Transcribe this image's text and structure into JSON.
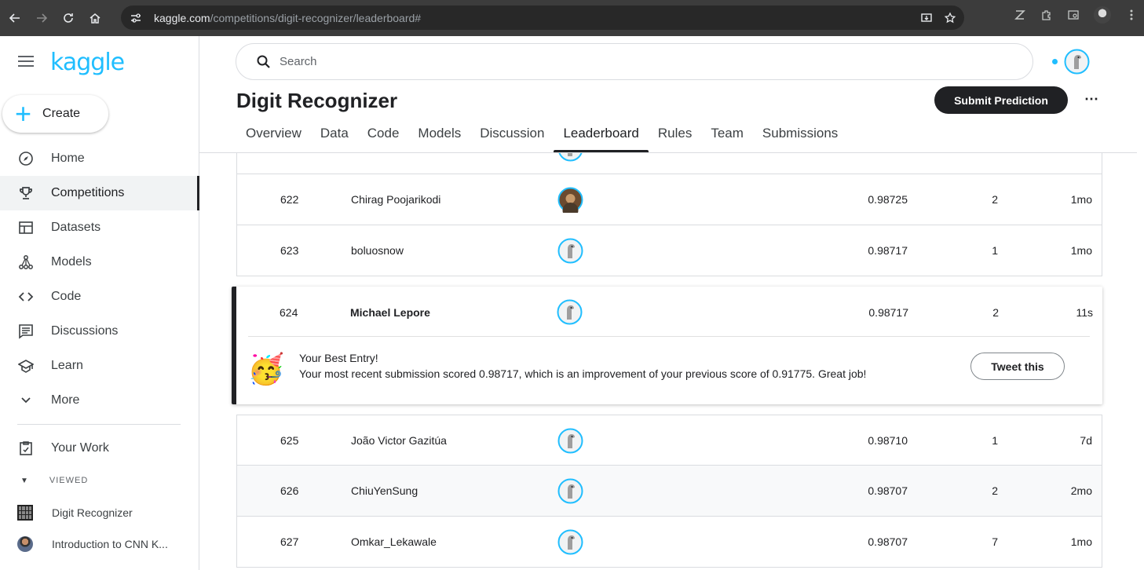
{
  "browser": {
    "url_domain": "kaggle.com",
    "url_path": "/competitions/digit-recognizer/leaderboard#"
  },
  "sidebar": {
    "logo": "kaggle",
    "create_label": "Create",
    "items": [
      {
        "label": "Home",
        "icon": "compass-icon"
      },
      {
        "label": "Competitions",
        "icon": "trophy-icon",
        "active": true
      },
      {
        "label": "Datasets",
        "icon": "table-icon"
      },
      {
        "label": "Models",
        "icon": "models-icon"
      },
      {
        "label": "Code",
        "icon": "code-icon"
      },
      {
        "label": "Discussions",
        "icon": "discussion-icon"
      },
      {
        "label": "Learn",
        "icon": "school-icon"
      },
      {
        "label": "More",
        "icon": "chevron-down-icon"
      }
    ],
    "your_work": "Your Work",
    "viewed_label": "VIEWED",
    "viewed": [
      {
        "label": "Digit Recognizer"
      },
      {
        "label": "Introduction to CNN K..."
      }
    ]
  },
  "search": {
    "placeholder": "Search"
  },
  "competition": {
    "title": "Digit Recognizer",
    "submit_label": "Submit Prediction",
    "tabs": [
      "Overview",
      "Data",
      "Code",
      "Models",
      "Discussion",
      "Leaderboard",
      "Rules",
      "Team",
      "Submissions"
    ],
    "active_tab": "Leaderboard"
  },
  "leaderboard": {
    "rows_before": [
      {
        "rank": "622",
        "team": "Chirag Poojarikodi",
        "score": "0.98725",
        "entries": "2",
        "last": "1mo"
      },
      {
        "rank": "623",
        "team": "boluosnow",
        "score": "0.98717",
        "entries": "1",
        "last": "1mo"
      }
    ],
    "highlight": {
      "rank": "624",
      "team": "Michael Lepore",
      "score": "0.98717",
      "entries": "2",
      "last": "11s",
      "msg_title": "Your Best Entry!",
      "msg_body": "Your most recent submission scored 0.98717, which is an improvement of your previous score of 0.91775. Great job!",
      "tweet_label": "Tweet this",
      "emoji": "🥳"
    },
    "rows_after": [
      {
        "rank": "625",
        "team": "João Victor Gazitúa",
        "score": "0.98710",
        "entries": "1",
        "last": "7d"
      },
      {
        "rank": "626",
        "team": "ChiuYenSung",
        "score": "0.98707",
        "entries": "2",
        "last": "2mo"
      },
      {
        "rank": "627",
        "team": "Omkar_Lekawale",
        "score": "0.98707",
        "entries": "7",
        "last": "1mo"
      }
    ]
  }
}
